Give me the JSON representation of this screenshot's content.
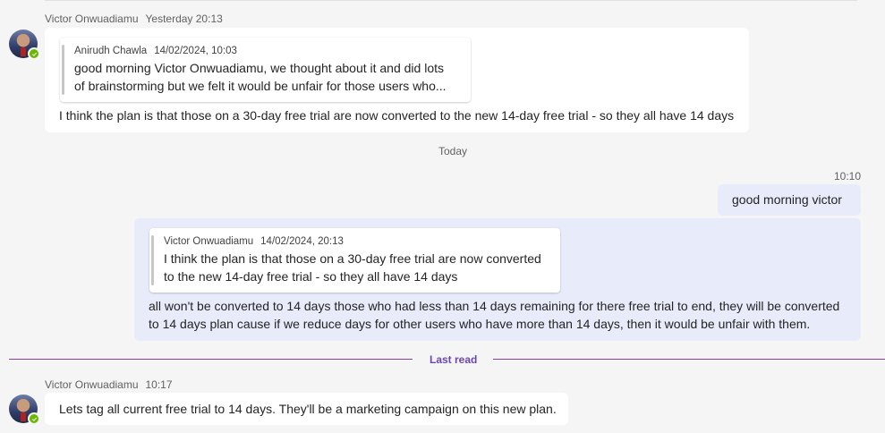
{
  "messages": [
    {
      "sender": "Victor Onwuadiamu",
      "time": "Yesterday 20:13",
      "quote": {
        "sender": "Anirudh Chawla",
        "time": "14/02/2024, 10:03",
        "line1": "good morning Victor Onwuadiamu, we thought about it and did lots",
        "line2": "of brainstorming but we felt it would be unfair for those users who..."
      },
      "text": "I think the plan is that those on a 30-day free trial are now converted to the new 14-day free trial - so they all have 14 days"
    },
    {
      "time": "10:10",
      "text": "good morning victor"
    },
    {
      "quote": {
        "sender": "Victor Onwuadiamu",
        "time": "14/02/2024, 20:13",
        "line1": "I think the plan is that those on a 30-day free trial are now converted",
        "line2": "to the new 14-day free trial - so they all have 14 days"
      },
      "line1": "all won't be converted to 14 days those who had less than 14 days remaining for there free trial to end, they will be converted",
      "line2": "to 14 days plan cause if we reduce days for other users who have more than 14 days, then it would be unfair with them."
    },
    {
      "sender": "Victor Onwuadiamu",
      "time": "10:17",
      "text": "Lets tag all current free trial to 14 days. They'll be a marketing campaign on this new plan."
    }
  ],
  "day_separator": "Today",
  "last_read_label": "Last read",
  "colors": {
    "presence": "#6bb700",
    "own_bubble": "#e8ebfa",
    "last_read": "#8a3f9e"
  }
}
